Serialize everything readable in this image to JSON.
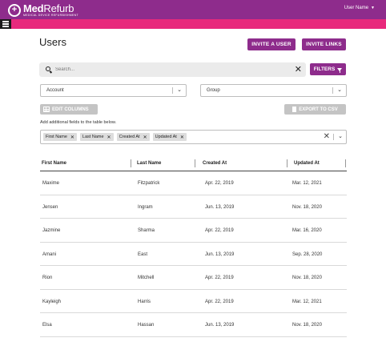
{
  "header": {
    "logo": {
      "name_bold": "Med",
      "name_light": "Refurb",
      "tagline": "MEDICAL DEVICE REFURBISHMENT"
    },
    "user_menu_label": "User Name",
    "brand_color": "#8e2c8c",
    "accent_color": "#e8297c"
  },
  "page": {
    "title": "Users"
  },
  "actions": {
    "invite_user": "INVITE A USER",
    "invite_links": "INVITE LINKS"
  },
  "search": {
    "placeholder": "Search...",
    "value": ""
  },
  "filters_label": "FILTERS",
  "selects": {
    "account": "Account",
    "group": "Group"
  },
  "edit_columns_label": "EDIT COLUMNS",
  "export_label": "EXPORT TO CSV",
  "helper_text": "Add additional fields to the table below.",
  "tags": [
    "First Name",
    "Last Name",
    "Created At",
    "Updated At"
  ],
  "table": {
    "columns": [
      "First Name",
      "Last Name",
      "Created At",
      "Updated At"
    ],
    "rows": [
      [
        "Maxime",
        "Fitzpatrick",
        "Apr. 22, 2019",
        "Mar. 12, 2021"
      ],
      [
        "Jensen",
        "Ingram",
        "Jun. 13, 2019",
        "Nov. 18, 2020"
      ],
      [
        "Jazmine",
        "Sharma",
        "Apr. 22, 2019",
        "Mar. 16, 2020"
      ],
      [
        "Amani",
        "East",
        "Jun. 13, 2019",
        "Sep. 28, 2020"
      ],
      [
        "Rion",
        "Mitchell",
        "Apr. 22, 2019",
        "Nov. 18, 2020"
      ],
      [
        "Kayleigh",
        "Harris",
        "Apr. 22, 2019",
        "Mar. 12, 2021"
      ],
      [
        "Elsa",
        "Hassan",
        "Jun. 13, 2019",
        "Nov. 18, 2020"
      ]
    ]
  }
}
